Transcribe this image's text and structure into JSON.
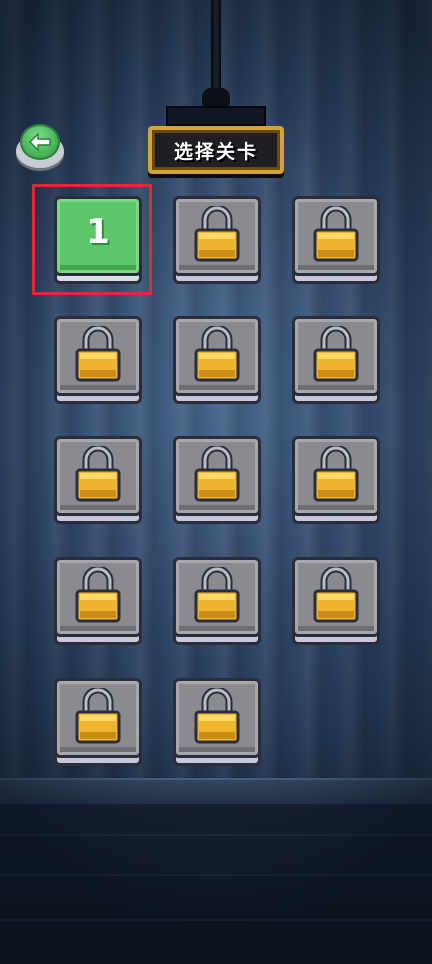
{
  "header": {
    "title": "选择关卡"
  },
  "back_button": {
    "icon": "back-arrow-icon"
  },
  "levels": [
    {
      "label": "1",
      "locked": false,
      "selected": true
    },
    {
      "label": "",
      "locked": true
    },
    {
      "label": "",
      "locked": true
    },
    {
      "label": "",
      "locked": true
    },
    {
      "label": "",
      "locked": true
    },
    {
      "label": "",
      "locked": true
    },
    {
      "label": "",
      "locked": true
    },
    {
      "label": "",
      "locked": true
    },
    {
      "label": "",
      "locked": true
    },
    {
      "label": "",
      "locked": true
    },
    {
      "label": "",
      "locked": true
    },
    {
      "label": "",
      "locked": true
    },
    {
      "label": "",
      "locked": true
    },
    {
      "label": "",
      "locked": true
    }
  ],
  "colors": {
    "unlocked_tile": "#5cc66a",
    "locked_tile": "#8a8b90",
    "lock_body": "#f0b52e",
    "selection_frame": "#e22a35",
    "sign_border": "#d6a33a"
  }
}
